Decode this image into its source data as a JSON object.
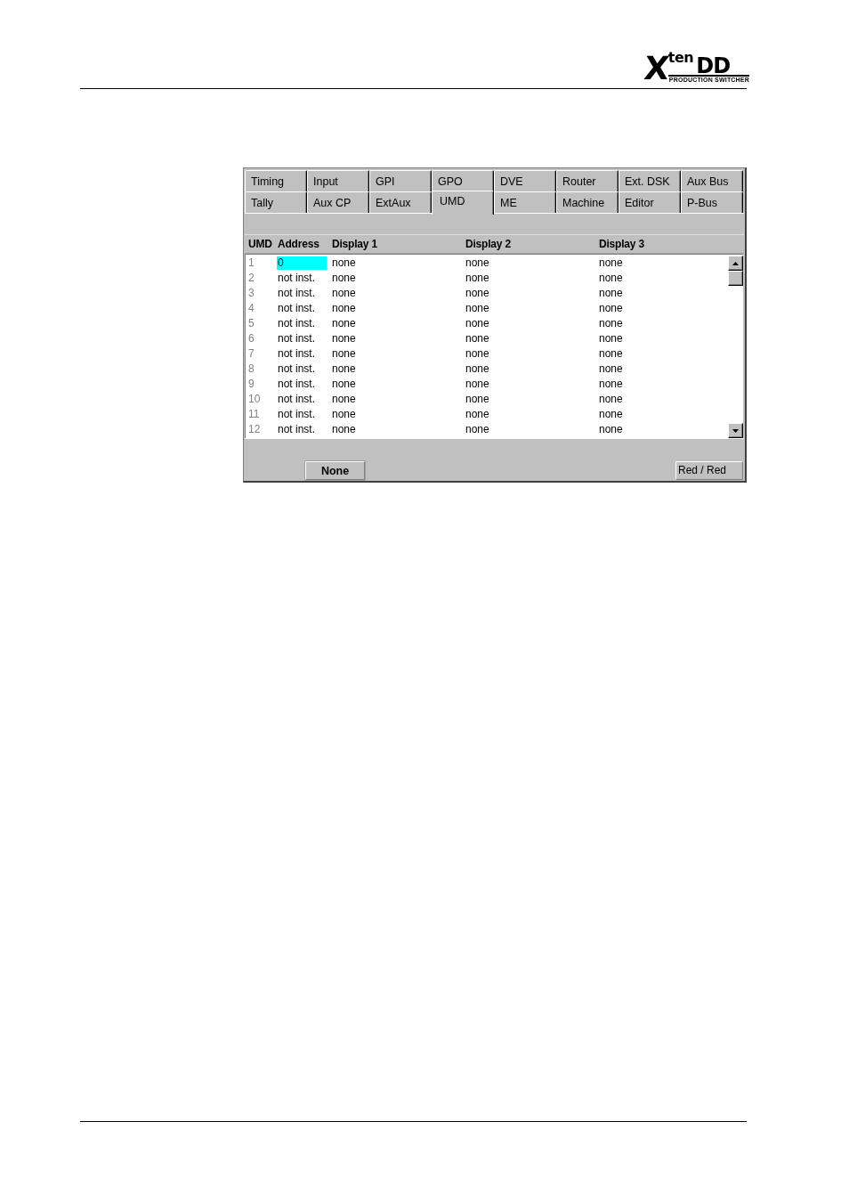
{
  "logo": {
    "mark": "X",
    "word": "ten",
    "suffix": "DD",
    "tagline": "PRODUCTION SWITCHER"
  },
  "tab_rows": [
    [
      {
        "label": "Timing",
        "selected": false
      },
      {
        "label": "Input",
        "selected": false
      },
      {
        "label": "GPI",
        "selected": false
      },
      {
        "label": "GPO",
        "selected": false
      },
      {
        "label": "DVE",
        "selected": false
      },
      {
        "label": "Router",
        "selected": false
      },
      {
        "label": "Ext. DSK",
        "selected": false
      },
      {
        "label": "Aux Bus",
        "selected": false
      }
    ],
    [
      {
        "label": "Tally",
        "selected": false
      },
      {
        "label": "Aux CP",
        "selected": false
      },
      {
        "label": "ExtAux",
        "selected": false
      },
      {
        "label": "UMD",
        "selected": true
      },
      {
        "label": "ME",
        "selected": false
      },
      {
        "label": "Machine",
        "selected": false
      },
      {
        "label": "Editor",
        "selected": false
      },
      {
        "label": "P-Bus",
        "selected": false
      }
    ]
  ],
  "table": {
    "columns": [
      "UMD",
      "Address",
      "Display 1",
      "Display 2",
      "Display 3"
    ],
    "rows": [
      {
        "cells": [
          "1",
          "0",
          "none",
          "none",
          "none"
        ],
        "selected": true
      },
      {
        "cells": [
          "2",
          "not inst.",
          "none",
          "none",
          "none"
        ],
        "selected": false
      },
      {
        "cells": [
          "3",
          "not inst.",
          "none",
          "none",
          "none"
        ],
        "selected": false
      },
      {
        "cells": [
          "4",
          "not inst.",
          "none",
          "none",
          "none"
        ],
        "selected": false
      },
      {
        "cells": [
          "5",
          "not inst.",
          "none",
          "none",
          "none"
        ],
        "selected": false
      },
      {
        "cells": [
          "6",
          "not inst.",
          "none",
          "none",
          "none"
        ],
        "selected": false
      },
      {
        "cells": [
          "7",
          "not inst.",
          "none",
          "none",
          "none"
        ],
        "selected": false
      },
      {
        "cells": [
          "8",
          "not inst.",
          "none",
          "none",
          "none"
        ],
        "selected": false
      },
      {
        "cells": [
          "9",
          "not inst.",
          "none",
          "none",
          "none"
        ],
        "selected": false
      },
      {
        "cells": [
          "10",
          "not inst.",
          "none",
          "none",
          "none"
        ],
        "selected": false
      },
      {
        "cells": [
          "11",
          "not inst.",
          "none",
          "none",
          "none"
        ],
        "selected": false
      },
      {
        "cells": [
          "12",
          "not inst.",
          "none",
          "none",
          "none"
        ],
        "selected": false
      }
    ]
  },
  "none_button": {
    "label": "None"
  },
  "status_field": {
    "value": "Red / Red"
  }
}
